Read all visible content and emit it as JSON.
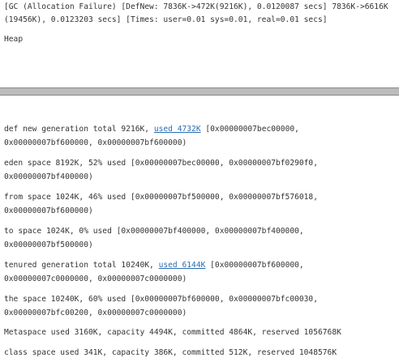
{
  "log": {
    "line": "[GC (Allocation Failure) [DefNew: 7836K->472K(9216K), 0.0120087 secs] 7836K->6616K(19456K), 0.0123203 secs] [Times: user=0.01 sys=0.01, real=0.01 secs]"
  },
  "heap_label": "Heap",
  "entries": [
    {
      "prefix": "def new generation total 9216K, ",
      "link": "used 4732K",
      "suffix": " [0x00000007bec00000,\n0x00000007bf600000, 0x00000007bf600000)"
    },
    {
      "text": "eden space 8192K, 52% used [0x00000007bec00000, 0x00000007bf0290f0,\n0x00000007bf400000)"
    },
    {
      "text": "from space 1024K, 46% used [0x00000007bf500000, 0x00000007bf576018,\n0x00000007bf600000)"
    },
    {
      "text": "to space 1024K, 0% used [0x00000007bf400000, 0x00000007bf400000,\n0x00000007bf500000)"
    },
    {
      "prefix": "tenured generation total 10240K, ",
      "link": "used 6144K",
      "suffix": " [0x00000007bf600000,\n0x00000007c0000000, 0x00000007c0000000)"
    },
    {
      "text": "the space 10240K, 60% used [0x00000007bf600000, 0x00000007bfc00030,\n0x00000007bfc00200, 0x00000007c0000000)"
    },
    {
      "text": "Metaspace used 3160K, capacity 4494K, committed 4864K, reserved 1056768K"
    },
    {
      "text": "class space used 341K, capacity 386K, committed 512K, reserved 1048576K"
    }
  ]
}
